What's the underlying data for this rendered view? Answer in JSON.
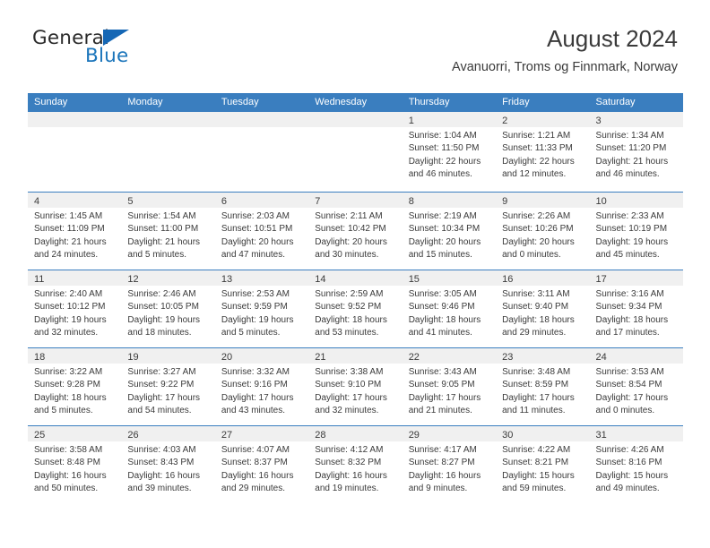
{
  "logo": {
    "primary_text": "General",
    "secondary_text": "Blue",
    "primary_color": "#2b2b2b",
    "secondary_color": "#1b75bb",
    "triangle_color": "#1567b5",
    "triangle_icon_name": "blue-triangle-icon"
  },
  "header": {
    "title": "August 2024",
    "subtitle": "Avanuorri, Troms og Finnmark, Norway"
  },
  "theme": {
    "header_band": "#3a7ebf",
    "day_band": "#f0f0f0",
    "text": "#3a3a3a",
    "cell_bg": "#ffffff"
  },
  "weekdays": [
    "Sunday",
    "Monday",
    "Tuesday",
    "Wednesday",
    "Thursday",
    "Friday",
    "Saturday"
  ],
  "weeks": [
    [
      {
        "day": "",
        "lines": []
      },
      {
        "day": "",
        "lines": []
      },
      {
        "day": "",
        "lines": []
      },
      {
        "day": "",
        "lines": []
      },
      {
        "day": "1",
        "lines": [
          "Sunrise: 1:04 AM",
          "Sunset: 11:50 PM",
          "Daylight: 22 hours",
          "and 46 minutes."
        ]
      },
      {
        "day": "2",
        "lines": [
          "Sunrise: 1:21 AM",
          "Sunset: 11:33 PM",
          "Daylight: 22 hours",
          "and 12 minutes."
        ]
      },
      {
        "day": "3",
        "lines": [
          "Sunrise: 1:34 AM",
          "Sunset: 11:20 PM",
          "Daylight: 21 hours",
          "and 46 minutes."
        ]
      }
    ],
    [
      {
        "day": "4",
        "lines": [
          "Sunrise: 1:45 AM",
          "Sunset: 11:09 PM",
          "Daylight: 21 hours",
          "and 24 minutes."
        ]
      },
      {
        "day": "5",
        "lines": [
          "Sunrise: 1:54 AM",
          "Sunset: 11:00 PM",
          "Daylight: 21 hours",
          "and 5 minutes."
        ]
      },
      {
        "day": "6",
        "lines": [
          "Sunrise: 2:03 AM",
          "Sunset: 10:51 PM",
          "Daylight: 20 hours",
          "and 47 minutes."
        ]
      },
      {
        "day": "7",
        "lines": [
          "Sunrise: 2:11 AM",
          "Sunset: 10:42 PM",
          "Daylight: 20 hours",
          "and 30 minutes."
        ]
      },
      {
        "day": "8",
        "lines": [
          "Sunrise: 2:19 AM",
          "Sunset: 10:34 PM",
          "Daylight: 20 hours",
          "and 15 minutes."
        ]
      },
      {
        "day": "9",
        "lines": [
          "Sunrise: 2:26 AM",
          "Sunset: 10:26 PM",
          "Daylight: 20 hours",
          "and 0 minutes."
        ]
      },
      {
        "day": "10",
        "lines": [
          "Sunrise: 2:33 AM",
          "Sunset: 10:19 PM",
          "Daylight: 19 hours",
          "and 45 minutes."
        ]
      }
    ],
    [
      {
        "day": "11",
        "lines": [
          "Sunrise: 2:40 AM",
          "Sunset: 10:12 PM",
          "Daylight: 19 hours",
          "and 32 minutes."
        ]
      },
      {
        "day": "12",
        "lines": [
          "Sunrise: 2:46 AM",
          "Sunset: 10:05 PM",
          "Daylight: 19 hours",
          "and 18 minutes."
        ]
      },
      {
        "day": "13",
        "lines": [
          "Sunrise: 2:53 AM",
          "Sunset: 9:59 PM",
          "Daylight: 19 hours",
          "and 5 minutes."
        ]
      },
      {
        "day": "14",
        "lines": [
          "Sunrise: 2:59 AM",
          "Sunset: 9:52 PM",
          "Daylight: 18 hours",
          "and 53 minutes."
        ]
      },
      {
        "day": "15",
        "lines": [
          "Sunrise: 3:05 AM",
          "Sunset: 9:46 PM",
          "Daylight: 18 hours",
          "and 41 minutes."
        ]
      },
      {
        "day": "16",
        "lines": [
          "Sunrise: 3:11 AM",
          "Sunset: 9:40 PM",
          "Daylight: 18 hours",
          "and 29 minutes."
        ]
      },
      {
        "day": "17",
        "lines": [
          "Sunrise: 3:16 AM",
          "Sunset: 9:34 PM",
          "Daylight: 18 hours",
          "and 17 minutes."
        ]
      }
    ],
    [
      {
        "day": "18",
        "lines": [
          "Sunrise: 3:22 AM",
          "Sunset: 9:28 PM",
          "Daylight: 18 hours",
          "and 5 minutes."
        ]
      },
      {
        "day": "19",
        "lines": [
          "Sunrise: 3:27 AM",
          "Sunset: 9:22 PM",
          "Daylight: 17 hours",
          "and 54 minutes."
        ]
      },
      {
        "day": "20",
        "lines": [
          "Sunrise: 3:32 AM",
          "Sunset: 9:16 PM",
          "Daylight: 17 hours",
          "and 43 minutes."
        ]
      },
      {
        "day": "21",
        "lines": [
          "Sunrise: 3:38 AM",
          "Sunset: 9:10 PM",
          "Daylight: 17 hours",
          "and 32 minutes."
        ]
      },
      {
        "day": "22",
        "lines": [
          "Sunrise: 3:43 AM",
          "Sunset: 9:05 PM",
          "Daylight: 17 hours",
          "and 21 minutes."
        ]
      },
      {
        "day": "23",
        "lines": [
          "Sunrise: 3:48 AM",
          "Sunset: 8:59 PM",
          "Daylight: 17 hours",
          "and 11 minutes."
        ]
      },
      {
        "day": "24",
        "lines": [
          "Sunrise: 3:53 AM",
          "Sunset: 8:54 PM",
          "Daylight: 17 hours",
          "and 0 minutes."
        ]
      }
    ],
    [
      {
        "day": "25",
        "lines": [
          "Sunrise: 3:58 AM",
          "Sunset: 8:48 PM",
          "Daylight: 16 hours",
          "and 50 minutes."
        ]
      },
      {
        "day": "26",
        "lines": [
          "Sunrise: 4:03 AM",
          "Sunset: 8:43 PM",
          "Daylight: 16 hours",
          "and 39 minutes."
        ]
      },
      {
        "day": "27",
        "lines": [
          "Sunrise: 4:07 AM",
          "Sunset: 8:37 PM",
          "Daylight: 16 hours",
          "and 29 minutes."
        ]
      },
      {
        "day": "28",
        "lines": [
          "Sunrise: 4:12 AM",
          "Sunset: 8:32 PM",
          "Daylight: 16 hours",
          "and 19 minutes."
        ]
      },
      {
        "day": "29",
        "lines": [
          "Sunrise: 4:17 AM",
          "Sunset: 8:27 PM",
          "Daylight: 16 hours",
          "and 9 minutes."
        ]
      },
      {
        "day": "30",
        "lines": [
          "Sunrise: 4:22 AM",
          "Sunset: 8:21 PM",
          "Daylight: 15 hours",
          "and 59 minutes."
        ]
      },
      {
        "day": "31",
        "lines": [
          "Sunrise: 4:26 AM",
          "Sunset: 8:16 PM",
          "Daylight: 15 hours",
          "and 49 minutes."
        ]
      }
    ]
  ]
}
